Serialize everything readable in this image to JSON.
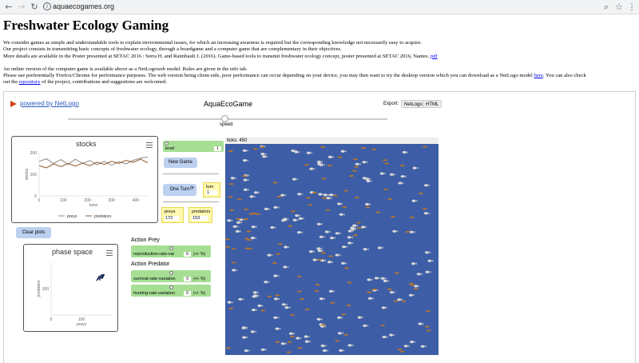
{
  "browser": {
    "url": "aquaecogames.org",
    "back_icon": "back-arrow-icon",
    "forward_icon": "forward-arrow-icon",
    "reload_icon": "reload-icon"
  },
  "page": {
    "title": "Freshwater Ecology Gaming",
    "intro_lines": [
      "We consider games as simple and understandable tools to explain environmental issues, for which an increasing awarness is required but the corresponding knowledge not necessarily easy to acquire.",
      "Our project consists in transmitting basic concepts of freshwater ecology, through a boardgame and a computer game that are complementary in their objectives.",
      "More details are available in the Poster presented at SETAC 2016 : Serra H. and Raimbault J. (2016). Game-based tools to transmit freshwater ecology concept, poster presented at SETAC 2016, Nantes."
    ],
    "pdf_link": "pdf",
    "para2_line1": "An online version of the computer game is available above as a NetLogoweb model. Rules are given in the info tab.",
    "para2_line2a": "Please use preferentially Firefox/Chrome for performance purposes. The web version being client-side, poor performance can occur depending on your device, you may then want to try the desktop version which you can download as a NetLogo model",
    "here_link": "here",
    "para2_line2b": ". You can also check",
    "para2_line3a": "out the",
    "repository_link": "repository",
    "para2_line3b": "of the project, contributions and suggestions are welcomed."
  },
  "netlogo": {
    "powered_by": "powered by NetLogo",
    "model_title": "AquaEcoGame",
    "export_label": "Export:",
    "export_netlogo": "NetLogo",
    "export_html": "HTML",
    "speed_label": "speed",
    "level_label": "level",
    "level_value": "1",
    "new_game": "New Game",
    "one_turn": "One Turn",
    "turn_label": "turn",
    "turn_value": "1",
    "preys_label": "preys",
    "preys_value": "172",
    "predators_label": "predators",
    "predators_value": "153",
    "clear_plots": "Clear plots",
    "action_prey": "Action Prey",
    "action_predator": "Action Predator",
    "repro_label": "reproduction-rate-var",
    "repro_value": "0",
    "survival_label": "survival-rate-variation",
    "survival_value": "0",
    "hunting_label": "hunting-rate-variation",
    "hunting_value": "0",
    "pm_unit": "(+/- %)",
    "ticks_label": "ticks: 450"
  },
  "chart_data": [
    {
      "type": "line",
      "title": "stocks",
      "xlabel": "turns",
      "ylabel": "stocks",
      "xlim": [
        0,
        450
      ],
      "ylim": [
        0,
        200
      ],
      "x_ticks": [
        "0",
        "100",
        "200",
        "300",
        "400"
      ],
      "y_ticks": [
        "0",
        "100",
        "200"
      ],
      "legend": "bottom",
      "series": [
        {
          "name": "preys",
          "color": "#8a8a8a",
          "x": [
            0,
            30,
            60,
            90,
            120,
            150,
            180,
            210,
            240,
            270,
            300,
            330,
            360,
            390,
            420,
            450
          ],
          "values": [
            160,
            172,
            150,
            168,
            146,
            170,
            150,
            164,
            144,
            160,
            142,
            158,
            148,
            165,
            175,
            180
          ]
        },
        {
          "name": "predators",
          "color": "#8b5a2b",
          "x": [
            0,
            30,
            60,
            90,
            120,
            150,
            180,
            210,
            240,
            270,
            300,
            330,
            360,
            390,
            420,
            450
          ],
          "values": [
            140,
            130,
            148,
            136,
            150,
            138,
            152,
            140,
            156,
            146,
            160,
            150,
            165,
            155,
            170,
            153
          ]
        }
      ]
    },
    {
      "type": "line",
      "title": "phase space",
      "xlabel": "preys",
      "ylabel": "predators",
      "xlim": [
        0,
        200
      ],
      "ylim": [
        0,
        200
      ],
      "x_ticks": [
        "0",
        "100"
      ],
      "y_ticks": [
        "100"
      ],
      "series": [
        {
          "color": "#1a2a5a",
          "x": [
            150,
            155,
            160,
            158,
            165,
            170,
            168,
            172,
            175,
            170,
            165,
            160,
            162,
            168,
            172
          ],
          "values": [
            130,
            140,
            135,
            145,
            140,
            150,
            138,
            148,
            155,
            145,
            150,
            142,
            148,
            152,
            153
          ]
        }
      ]
    }
  ]
}
